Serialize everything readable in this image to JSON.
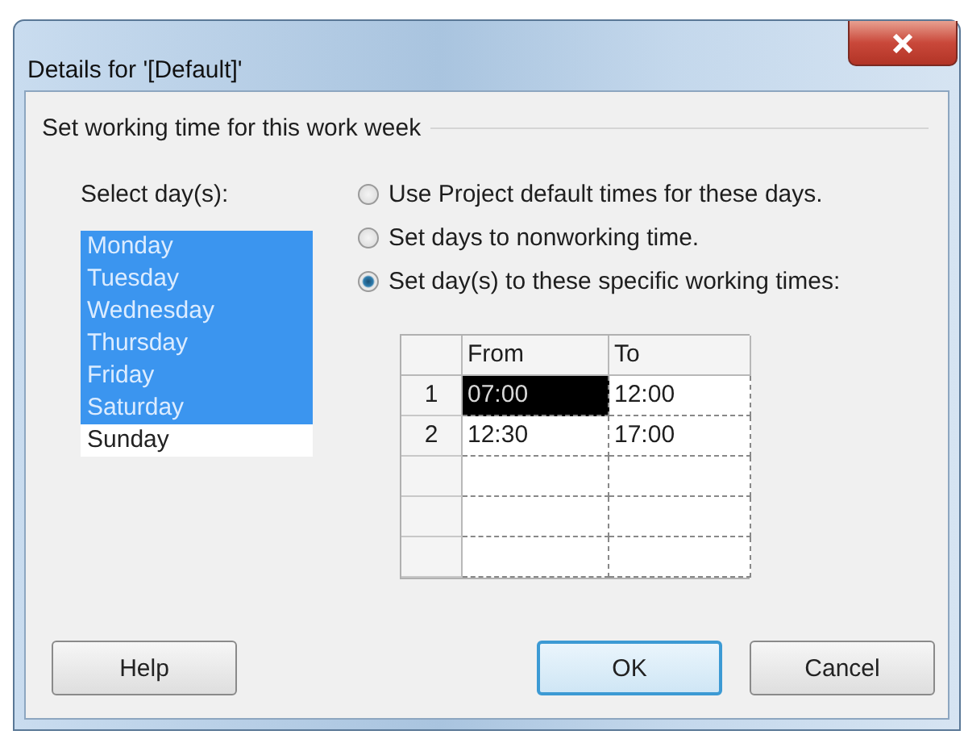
{
  "window": {
    "title": "Details for '[Default]'"
  },
  "group": {
    "title": "Set working time for this work week"
  },
  "day_picker": {
    "label": "Select day(s):",
    "days": [
      {
        "label": "Monday",
        "selected": true
      },
      {
        "label": "Tuesday",
        "selected": true
      },
      {
        "label": "Wednesday",
        "selected": true
      },
      {
        "label": "Thursday",
        "selected": true
      },
      {
        "label": "Friday",
        "selected": true
      },
      {
        "label": "Saturday",
        "selected": true
      },
      {
        "label": "Sunday",
        "selected": false
      }
    ]
  },
  "options": [
    {
      "label": "Use Project default times for these days.",
      "selected": false
    },
    {
      "label": "Set days to nonworking time.",
      "selected": false
    },
    {
      "label": "Set day(s) to these specific working times:",
      "selected": true
    }
  ],
  "table": {
    "columns": [
      "From",
      "To"
    ],
    "rows": [
      {
        "number": "1",
        "cells": [
          {
            "value": "07:00",
            "selected": true
          },
          {
            "value": "12:00",
            "selected": false
          }
        ]
      },
      {
        "number": "2",
        "cells": [
          {
            "value": "12:30",
            "selected": false
          },
          {
            "value": "17:00",
            "selected": false
          }
        ]
      }
    ]
  },
  "buttons": [
    {
      "label": "Help",
      "default": false
    },
    {
      "label": "OK",
      "default": true
    },
    {
      "label": "Cancel",
      "default": false
    }
  ]
}
